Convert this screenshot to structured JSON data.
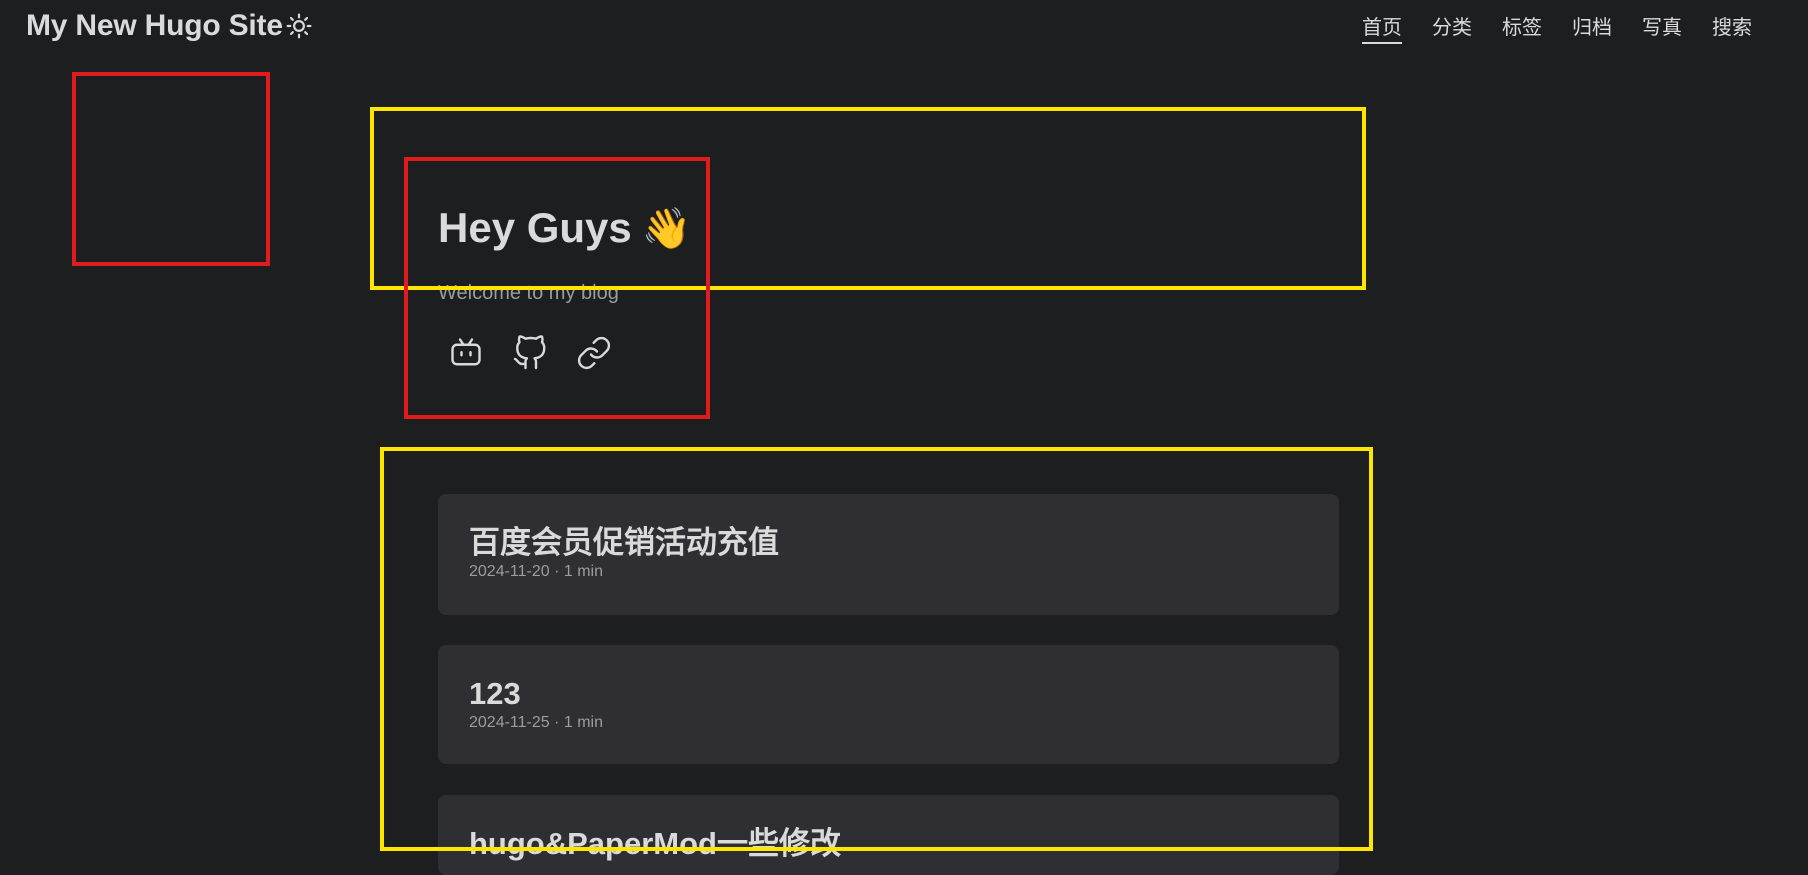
{
  "header": {
    "site_title": "My New Hugo Site",
    "theme_icon": "sun-icon"
  },
  "nav": {
    "items": [
      {
        "label": "首页",
        "active": true
      },
      {
        "label": "分类",
        "active": false
      },
      {
        "label": "标签",
        "active": false
      },
      {
        "label": "归档",
        "active": false
      },
      {
        "label": "写真",
        "active": false
      },
      {
        "label": "搜索",
        "active": false
      }
    ]
  },
  "hero": {
    "title": "Hey Guys",
    "emoji": "👋",
    "subtitle": "Welcome to my blog",
    "socials": [
      "bilibili-icon",
      "github-icon",
      "link-icon"
    ]
  },
  "posts": [
    {
      "title": "百度会员促销活动充值",
      "meta": "2024-11-20 · 1 min"
    },
    {
      "title": "123",
      "meta": "2024-11-25 · 1 min"
    },
    {
      "title": "hugo&PaperMod一些修改",
      "meta": ""
    }
  ],
  "colors": {
    "background": "#1d1e20",
    "card": "#2e2e33",
    "text": "#dadadb",
    "secondary": "#9b9c9d",
    "annotation_red": "#e01b1b",
    "annotation_yellow": "#ffe500"
  }
}
